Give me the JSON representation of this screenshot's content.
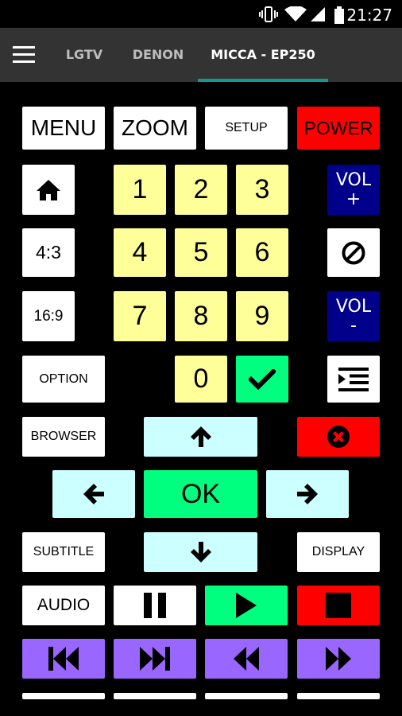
{
  "status_bar": {
    "time": "21:27",
    "icons": [
      "vibrate-icon",
      "wifi-icon",
      "signal-icon",
      "battery-icon"
    ]
  },
  "app_bar": {
    "tabs": [
      {
        "label": "LGTV",
        "active": false
      },
      {
        "label": "DENON",
        "active": false
      },
      {
        "label": "MICCA - EP250",
        "active": true
      }
    ],
    "accent_color": "#109b94"
  },
  "remote": {
    "menu": "MENU",
    "zoom": "ZOOM",
    "setup": "SETUP",
    "power": "POWER",
    "aspect_4_3": "4:3",
    "aspect_16_9": "16:9",
    "option": "OPTION",
    "browser": "BROWSER",
    "subtitle": "SUBTITLE",
    "display": "DISPLAY",
    "audio": "AUDIO",
    "ok": "OK",
    "vol_label": "VOL",
    "vol_plus": "+",
    "vol_minus": "-",
    "digits": [
      "1",
      "2",
      "3",
      "4",
      "5",
      "6",
      "7",
      "8",
      "9",
      "0"
    ]
  },
  "colors": {
    "white": "#ffffff",
    "yellow": "#ffff99",
    "red": "#ff0000",
    "green": "#00ff7f",
    "cyan": "#ccffff",
    "navy": "#00008b",
    "purple": "#9966ff",
    "app_bar": "#333333"
  }
}
